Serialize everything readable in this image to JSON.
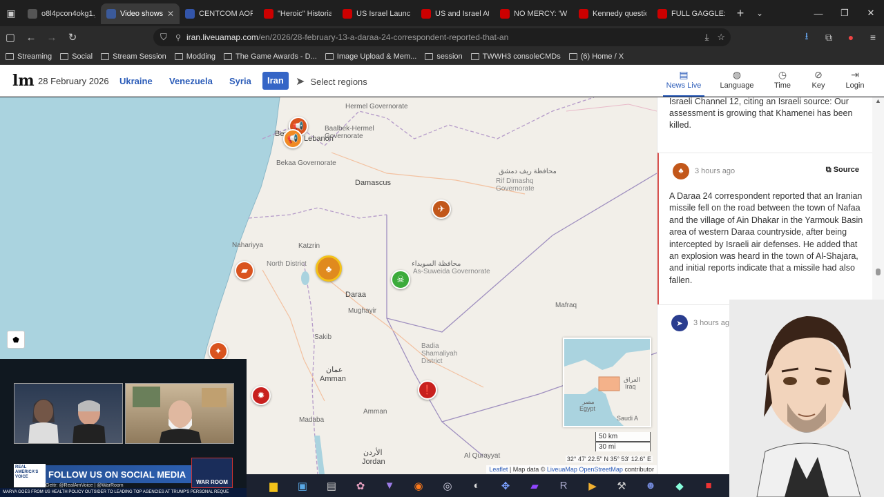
{
  "browser": {
    "tabs": [
      {
        "label": "o8l4pcon4okg1.jpeg (",
        "color": "#555555"
      },
      {
        "label": "Video shows fc",
        "color": "#3b5a9a",
        "active": true
      },
      {
        "label": "CENTCOM AOR",
        "color": "#3355aa"
      },
      {
        "label": "\"Heroic\" Historian",
        "color": "#cc0000"
      },
      {
        "label": "US Israel Launch J",
        "color": "#cc0000"
      },
      {
        "label": "US and Israel Atta",
        "color": "#cc0000"
      },
      {
        "label": "NO MERCY: 'Why",
        "color": "#cc0000"
      },
      {
        "label": "Kennedy question",
        "color": "#cc0000"
      },
      {
        "label": "FULL GAGGLE: Ru",
        "color": "#cc0000"
      }
    ],
    "url_host": "iran.liveuamap.com",
    "url_path": "/en/2026/28-february-13-a-daraa-24-correspondent-reported-that-an",
    "bookmarks": [
      "Streaming",
      "Social",
      "Stream Session",
      "Modding",
      "The Game Awards - D...",
      "Image Upload & Mem...",
      "session",
      "TWWH3 consoleCMDs",
      "(6) Home / X"
    ]
  },
  "site": {
    "logo": "lm",
    "date": "28 February 2026",
    "regions": [
      "Ukraine",
      "Venezuela",
      "Syria",
      "Iran"
    ],
    "active_region": "Iran",
    "select_regions": "Select regions",
    "topnav": [
      {
        "label": "News Live",
        "icon": "news-icon",
        "active": true
      },
      {
        "label": "Language",
        "icon": "language-icon"
      },
      {
        "label": "Time",
        "icon": "clock-icon"
      },
      {
        "label": "Key",
        "icon": "compass-icon"
      },
      {
        "label": "Login",
        "icon": "login-icon"
      }
    ]
  },
  "map": {
    "labels": {
      "beirut": "Beirut",
      "lebanon": "Lebanon",
      "hermel": "Hermel Governorate",
      "baalbek": "Baalbek-Hermel Governorate",
      "bekaa": "Bekaa Governorate",
      "damascus": "Damascus",
      "rif_ar": "محافظة ريف دمشق",
      "rif_en": "Rif Dimashq Governorate",
      "nahariyya": "Nahariyya",
      "north_district": "North District",
      "katzrin": "Katzrin",
      "sweida_ar": "محافظة السويداء",
      "sweida_en": "As-Suweida Governorate",
      "daraa": "Daraa",
      "mughayir": "Mughayir",
      "mafraq": "Mafraq",
      "sakib": "Sakib",
      "amman": "Amman",
      "amman_ar": "عمان",
      "jordan": "Jordan",
      "jordan_ar": "الأردن",
      "madaba": "Madaba",
      "al_qurayyat": "Al Qurayyat",
      "badia": "Badia Shamaliyah District",
      "iraq": "Iraq",
      "iraq_ar": "العراق",
      "egypt": "Egypt",
      "egypt_ar": "مصر",
      "saudi": "Saudi A"
    },
    "scale_km": "50 km",
    "scale_mi": "30 mi",
    "coords": "32° 47' 22.5\" N 35° 53' 12.6\" E",
    "attribution_leaflet": "Leaflet",
    "attribution_text": "| Map data ©",
    "attribution_link": "LiveuaMap OpenStreetMap",
    "attribution_tail": "contributor"
  },
  "news": {
    "previous_text": "Israeli Channel 12, citing an Israeli source: Our assessment is growing that Khamenei has been killed.",
    "items": [
      {
        "ago": "3 hours ago",
        "source": "Source",
        "icon": "missile-impact-icon",
        "text": "A Daraa 24 correspondent reported that an Iranian missile fell on the road between the town of Nafaa and the village of Ain Dhakar in the Yarmouk Basin area of western Daraa countryside, after being intercepted by Israeli air defenses. He added that an explosion was heard in the town of Al-Shajara, and initial reports indicate that a missile had also fallen."
      },
      {
        "ago": "3 hours ago",
        "icon": "airplane-icon",
        "text": ""
      }
    ]
  },
  "overlay": {
    "banner": "FOLLOW US ON SOCIAL MEDIA",
    "handle": "Gettr: @RealAmVoice | @WarRoom",
    "ticker": "MARYA GOES FROM US HEALTH POLICY OUTSIDER TO LEADING TOP AGENCIES AT TRUMP'S PERSONAL REQUE",
    "logo_text": "REAL AMERICA'S VOICE",
    "warroom": "WAR ROOM"
  }
}
